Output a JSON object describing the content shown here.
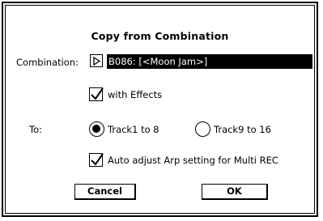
{
  "dialog": {
    "title": "Copy from Combination",
    "combination_label": "Combination:",
    "combination_value": "B086: [<Moon Jam>]",
    "with_effects": {
      "label": "with Effects",
      "checked": true
    },
    "to_label": "To:",
    "to_options": [
      {
        "label": "Track1 to 8",
        "selected": true
      },
      {
        "label": "Track9 to 16",
        "selected": false
      }
    ],
    "auto_adjust": {
      "label": "Auto adjust Arp setting for Multi REC",
      "checked": true
    },
    "buttons": {
      "cancel": "Cancel",
      "ok": "OK"
    }
  }
}
